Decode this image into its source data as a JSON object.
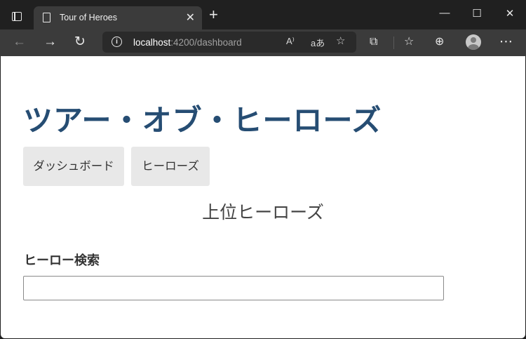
{
  "browser": {
    "tab_title": "Tour of Heroes",
    "tab_close": "✕",
    "new_tab": "+",
    "url_host": "localhost",
    "url_rest": ":4200/dashboard",
    "read_aloud": "A⁾",
    "translate": "aあ",
    "info": "i"
  },
  "app": {
    "title": "ツアー・オブ・ヒーローズ",
    "nav": {
      "dashboard": "ダッシュボード",
      "heroes": "ヒーローズ"
    },
    "dashboard_heading": "上位ヒーローズ",
    "search_label": "ヒーロー検索",
    "search_value": ""
  }
}
